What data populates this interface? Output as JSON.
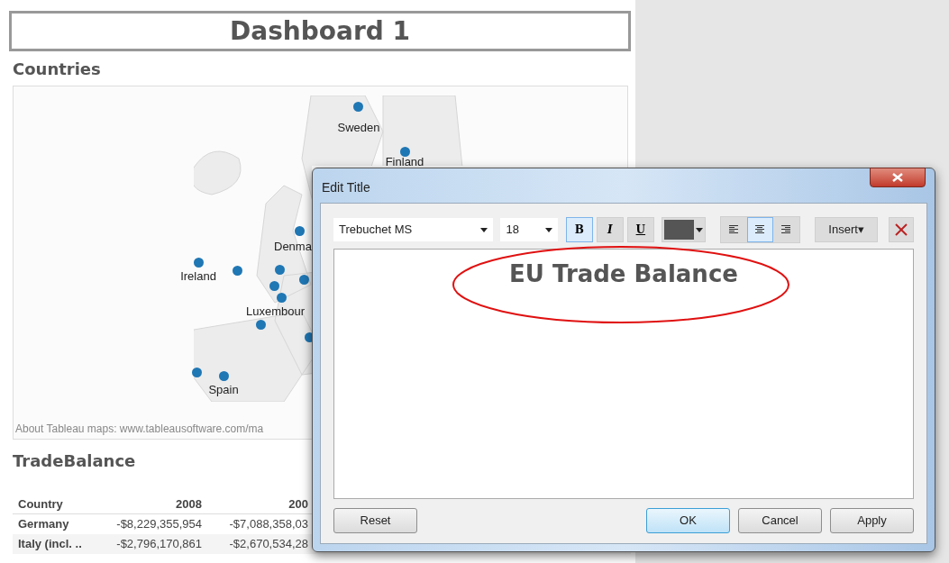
{
  "dashboard": {
    "title": "Dashboard 1"
  },
  "map_section": {
    "title": "Countries",
    "attribution": "About Tableau maps: www.tableausoftware.com/ma",
    "markers": [
      {
        "kind": "labeled",
        "label": "Sweden"
      },
      {
        "kind": "labeled",
        "label": "Finland"
      },
      {
        "kind": "labeled",
        "label": "Denma"
      },
      {
        "kind": "labeled",
        "label": "Ireland"
      },
      {
        "kind": "plain"
      },
      {
        "kind": "plain"
      },
      {
        "kind": "plain"
      },
      {
        "kind": "plain"
      },
      {
        "kind": "labeled",
        "label": "Luxembour"
      },
      {
        "kind": "plain"
      },
      {
        "kind": "plain"
      },
      {
        "kind": "plain"
      },
      {
        "kind": "labeled",
        "label": "Spain"
      }
    ]
  },
  "table_section": {
    "title": "TradeBalance",
    "columns": [
      "Country",
      "2008",
      "200"
    ],
    "rows": [
      [
        "Germany",
        "-$8,229,355,954",
        "-$7,088,358,03"
      ],
      [
        "Italy (incl. ..",
        "-$2,796,170,861",
        "-$2,670,534,28"
      ]
    ]
  },
  "dialog": {
    "title": "Edit Title",
    "font": "Trebuchet MS",
    "size": "18",
    "format_buttons": [
      {
        "kind": "bold",
        "label": "B",
        "selected": true
      },
      {
        "kind": "italic",
        "label": "I",
        "selected": false
      },
      {
        "kind": "underline",
        "label": "U",
        "selected": false
      }
    ],
    "align_buttons": [
      {
        "kind": "left",
        "selected": false
      },
      {
        "kind": "center",
        "selected": true
      },
      {
        "kind": "right",
        "selected": false
      }
    ],
    "insert_label": "Insert▾",
    "content": "EU Trade Balance",
    "buttons": [
      {
        "label": "Reset",
        "kind": "reset"
      },
      {
        "label": "OK",
        "kind": "default"
      },
      {
        "label": "Cancel",
        "kind": "normal"
      },
      {
        "label": "Apply",
        "kind": "normal"
      }
    ]
  }
}
